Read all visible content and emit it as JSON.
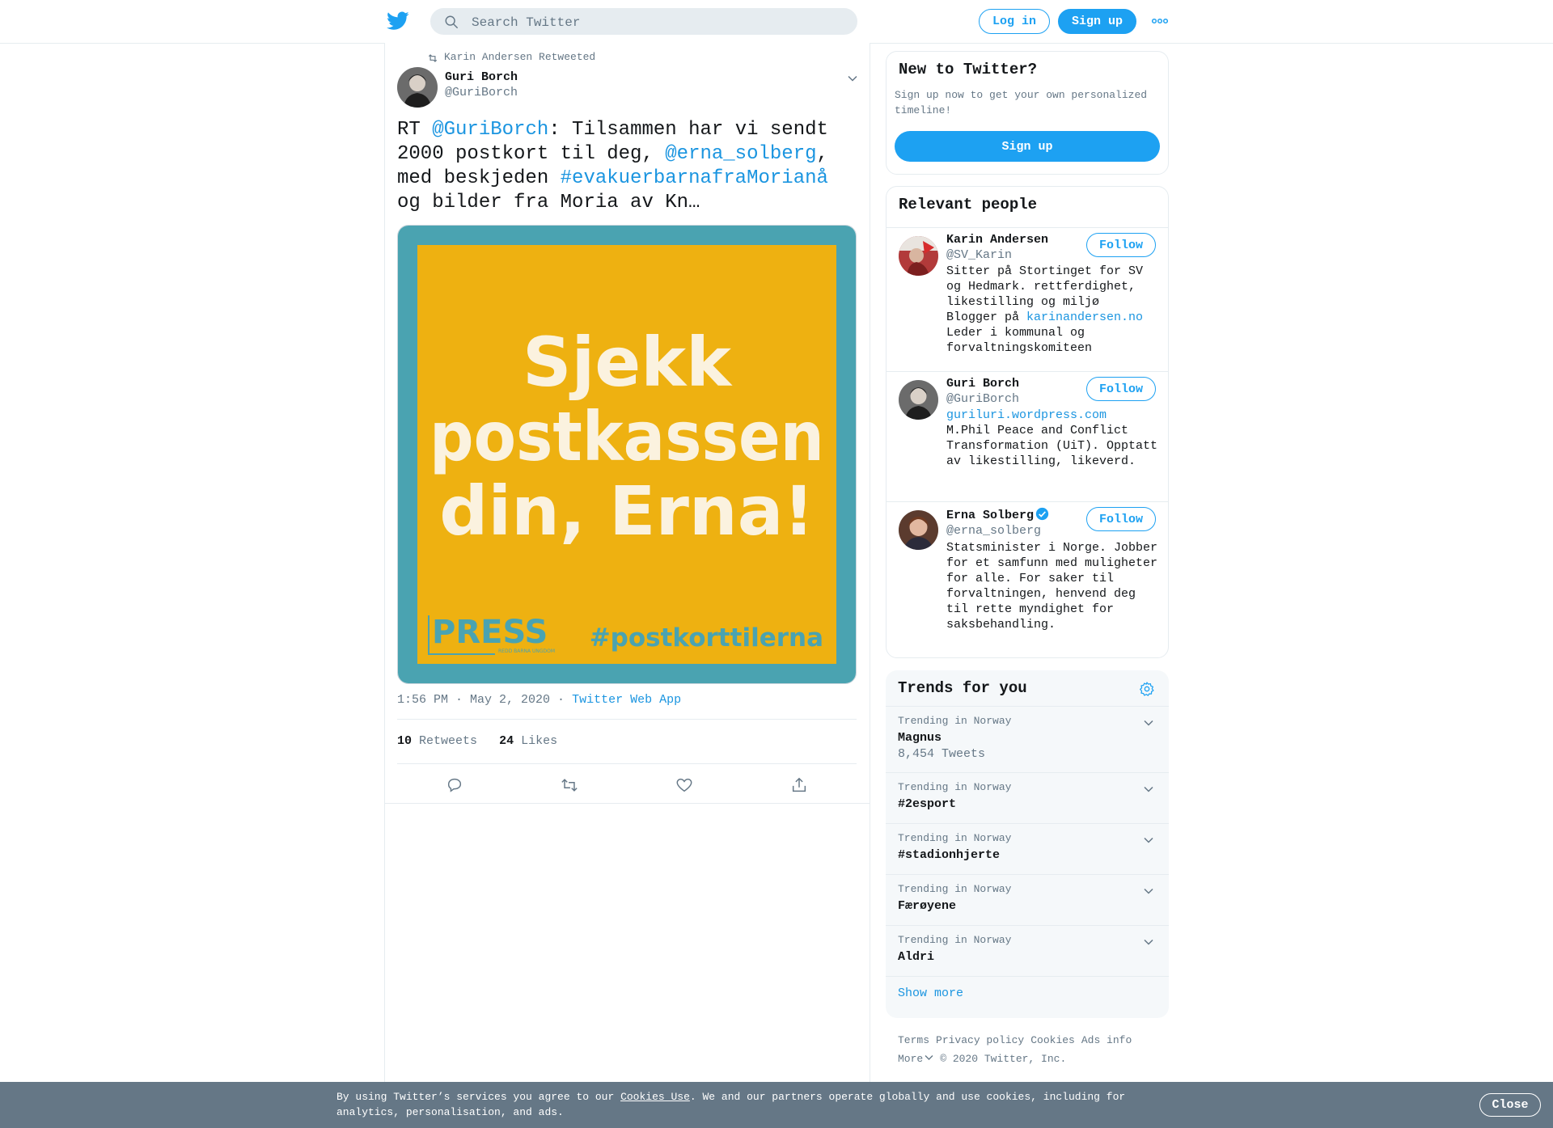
{
  "header": {
    "search_placeholder": "Search Twitter",
    "login_label": "Log in",
    "signup_label": "Sign up"
  },
  "tweet": {
    "retweeted_by": "Karin Andersen Retweeted",
    "author_name": "Guri Borch",
    "author_handle": "@GuriBorch",
    "text_parts": {
      "p1": "RT ",
      "m1": "@GuriBorch",
      "p2": ": Tilsammen har vi sendt 2000 postkort til deg, ",
      "m2": "@erna_solberg",
      "p3": ", med beskjeden ",
      "h1": "#evakuerbarnafraMorianå",
      "p4": " og bilder fra Moria av Kn…"
    },
    "media": {
      "headline_lines": [
        "Sjekk",
        "postkassen",
        "din, Erna!"
      ],
      "logo_text": "PRESS",
      "logo_subtext": "REDD BARNA UNGDOM",
      "hashtag": "#postkorttilerna",
      "bg_color": "#4aa3b1",
      "panel_color": "#eeb111"
    },
    "time": "1:56 PM · May 2, 2020",
    "separator": "·",
    "source": "Twitter Web App",
    "retweets_count": "10",
    "retweets_label": "Retweets",
    "likes_count": "24",
    "likes_label": "Likes"
  },
  "sidebar": {
    "new_to_twitter": {
      "title": "New to Twitter?",
      "subtitle": "Sign up now to get your own personalized timeline!",
      "signup_label": "Sign up"
    },
    "relevant_people": {
      "title": "Relevant people",
      "follow_label": "Follow",
      "people": [
        {
          "name": "Karin Andersen",
          "handle": "@SV_Karin",
          "bio_1": "Sitter på Stortinget for SV og Hedmark. rettferdighet, likestilling og miljø",
          "bio_2": "Blogger på ",
          "bio_link": "karinandersen.no",
          "bio_3": "Leder i kommunal og forvaltningskomiteen"
        },
        {
          "name": "Guri Borch",
          "handle": "@GuriBorch",
          "bio_link": "guriluri.wordpress.com",
          "bio_1": "M.Phil Peace and Conflict Transformation (UiT). Opptatt av likestilling, likeverd."
        },
        {
          "name": "Erna Solberg",
          "handle": "@erna_solberg",
          "verified": true,
          "bio_1": "Statsminister i Norge. Jobber for et samfunn med muligheter for alle. For saker til forvaltningen, henvend deg til rette myndighet for saksbehandling."
        }
      ]
    },
    "trends": {
      "title": "Trends for you",
      "items": [
        {
          "context": "Trending in Norway",
          "name": "Magnus",
          "count": "8,454 Tweets"
        },
        {
          "context": "Trending in Norway",
          "name": "#2esport"
        },
        {
          "context": "Trending in Norway",
          "name": "#stadionhjerte"
        },
        {
          "context": "Trending in Norway",
          "name": "Færøyene"
        },
        {
          "context": "Trending in Norway",
          "name": "Aldri"
        }
      ],
      "show_more": "Show more"
    },
    "footer": {
      "links": [
        "Terms",
        "Privacy policy",
        "Cookies",
        "Ads info"
      ],
      "more_label": "More",
      "copyright": "© 2020 Twitter, Inc."
    }
  },
  "cookie_bar": {
    "text_before": "By using Twitter’s services you agree to our ",
    "link": "Cookies Use",
    "text_after": ". We and our partners operate globally and use cookies, including for analytics, personalisation, and ads.",
    "close_label": "Close"
  },
  "colors": {
    "accent": "#1da1f2",
    "link": "#1b95e0",
    "text": "#14171a",
    "muted": "#657786",
    "cookie_bar": "#657786"
  }
}
